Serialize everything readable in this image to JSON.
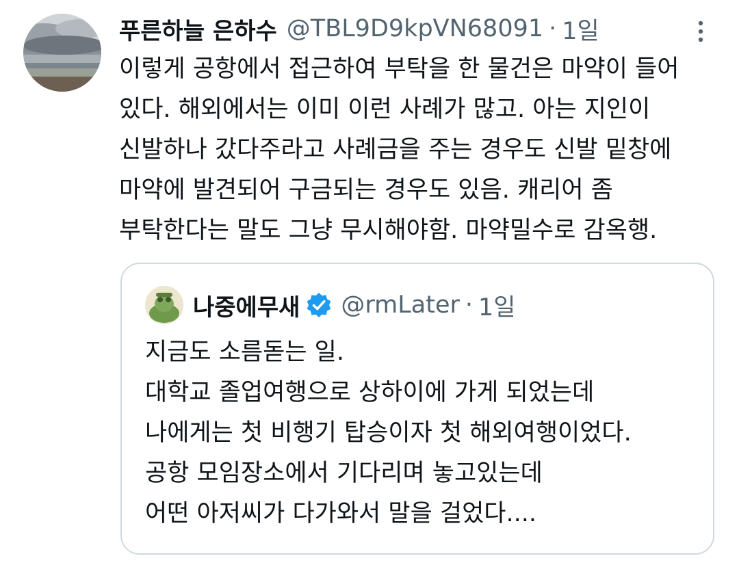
{
  "tweet": {
    "display_name": "푸른하늘 은하수",
    "handle": "@TBL9D9kpVN68091",
    "separator": "·",
    "time": "1일",
    "lines": [
      "이렇게 공항에서 접근하여 부탁을 한 물건은 마약이 들어",
      "있다. 해외에서는 이미 이런 사례가 많고. 아는 지인이",
      "신발하나 갔다주라고 사례금을 주는 경우도 신발 밑창에",
      "마약에 발견되어 구금되는 경우도 있음. 캐리어 좀",
      "부탁한다는 말도 그냥 무시해야함. 마약밀수로 감옥행."
    ],
    "avatar_icon": "landscape-photo-avatar",
    "more_icon": "more-vertical-icon"
  },
  "quote": {
    "display_name": "나중에무새",
    "handle": "@rmLater",
    "separator": "·",
    "time": "1일",
    "verified_icon": "verified-badge-icon",
    "verified_color": "#1d9bf0",
    "lines": [
      "지금도 소름돋는 일.",
      "대학교 졸업여행으로 상하이에 가게 되었는데",
      "나에게는 첫 비행기 탑승이자 첫 해외여행이었다.",
      "공항 모임장소에서 기다리며 놓고있는데",
      "어떤 아저씨가 다가와서 말을 걸었다...."
    ]
  },
  "colors": {
    "text_primary": "#0f1419",
    "text_secondary": "#536471",
    "border": "#cfd9de",
    "accent": "#1d9bf0"
  }
}
